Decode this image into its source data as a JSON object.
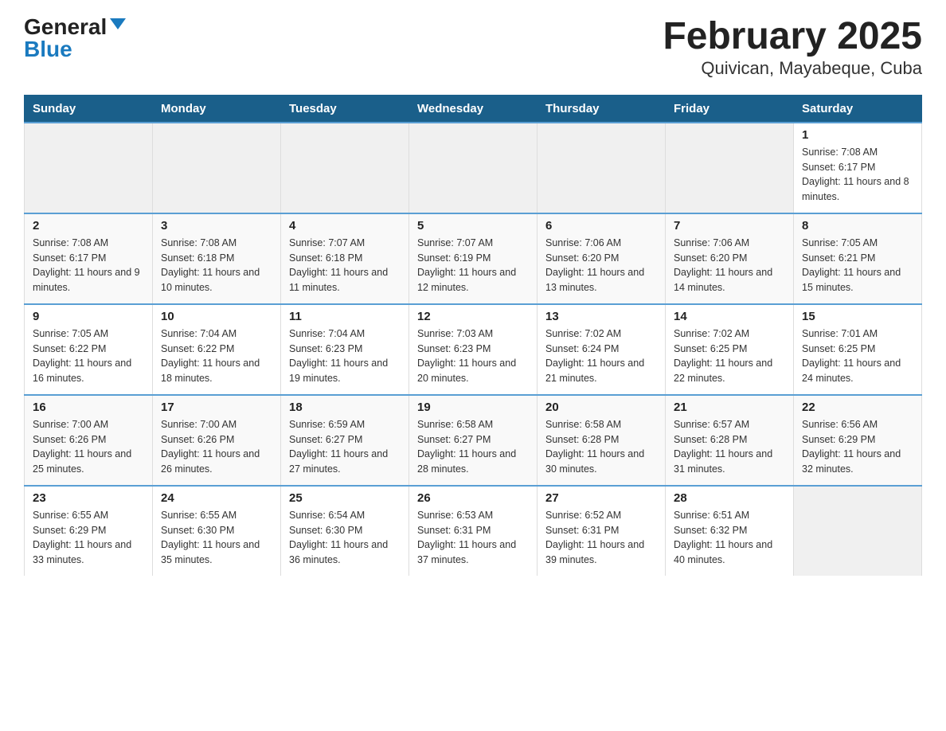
{
  "logo": {
    "general": "General",
    "blue": "Blue"
  },
  "title": "February 2025",
  "subtitle": "Quivican, Mayabeque, Cuba",
  "weekdays": [
    "Sunday",
    "Monday",
    "Tuesday",
    "Wednesday",
    "Thursday",
    "Friday",
    "Saturday"
  ],
  "weeks": [
    [
      {
        "day": "",
        "info": ""
      },
      {
        "day": "",
        "info": ""
      },
      {
        "day": "",
        "info": ""
      },
      {
        "day": "",
        "info": ""
      },
      {
        "day": "",
        "info": ""
      },
      {
        "day": "",
        "info": ""
      },
      {
        "day": "1",
        "info": "Sunrise: 7:08 AM\nSunset: 6:17 PM\nDaylight: 11 hours and 8 minutes."
      }
    ],
    [
      {
        "day": "2",
        "info": "Sunrise: 7:08 AM\nSunset: 6:17 PM\nDaylight: 11 hours and 9 minutes."
      },
      {
        "day": "3",
        "info": "Sunrise: 7:08 AM\nSunset: 6:18 PM\nDaylight: 11 hours and 10 minutes."
      },
      {
        "day": "4",
        "info": "Sunrise: 7:07 AM\nSunset: 6:18 PM\nDaylight: 11 hours and 11 minutes."
      },
      {
        "day": "5",
        "info": "Sunrise: 7:07 AM\nSunset: 6:19 PM\nDaylight: 11 hours and 12 minutes."
      },
      {
        "day": "6",
        "info": "Sunrise: 7:06 AM\nSunset: 6:20 PM\nDaylight: 11 hours and 13 minutes."
      },
      {
        "day": "7",
        "info": "Sunrise: 7:06 AM\nSunset: 6:20 PM\nDaylight: 11 hours and 14 minutes."
      },
      {
        "day": "8",
        "info": "Sunrise: 7:05 AM\nSunset: 6:21 PM\nDaylight: 11 hours and 15 minutes."
      }
    ],
    [
      {
        "day": "9",
        "info": "Sunrise: 7:05 AM\nSunset: 6:22 PM\nDaylight: 11 hours and 16 minutes."
      },
      {
        "day": "10",
        "info": "Sunrise: 7:04 AM\nSunset: 6:22 PM\nDaylight: 11 hours and 18 minutes."
      },
      {
        "day": "11",
        "info": "Sunrise: 7:04 AM\nSunset: 6:23 PM\nDaylight: 11 hours and 19 minutes."
      },
      {
        "day": "12",
        "info": "Sunrise: 7:03 AM\nSunset: 6:23 PM\nDaylight: 11 hours and 20 minutes."
      },
      {
        "day": "13",
        "info": "Sunrise: 7:02 AM\nSunset: 6:24 PM\nDaylight: 11 hours and 21 minutes."
      },
      {
        "day": "14",
        "info": "Sunrise: 7:02 AM\nSunset: 6:25 PM\nDaylight: 11 hours and 22 minutes."
      },
      {
        "day": "15",
        "info": "Sunrise: 7:01 AM\nSunset: 6:25 PM\nDaylight: 11 hours and 24 minutes."
      }
    ],
    [
      {
        "day": "16",
        "info": "Sunrise: 7:00 AM\nSunset: 6:26 PM\nDaylight: 11 hours and 25 minutes."
      },
      {
        "day": "17",
        "info": "Sunrise: 7:00 AM\nSunset: 6:26 PM\nDaylight: 11 hours and 26 minutes."
      },
      {
        "day": "18",
        "info": "Sunrise: 6:59 AM\nSunset: 6:27 PM\nDaylight: 11 hours and 27 minutes."
      },
      {
        "day": "19",
        "info": "Sunrise: 6:58 AM\nSunset: 6:27 PM\nDaylight: 11 hours and 28 minutes."
      },
      {
        "day": "20",
        "info": "Sunrise: 6:58 AM\nSunset: 6:28 PM\nDaylight: 11 hours and 30 minutes."
      },
      {
        "day": "21",
        "info": "Sunrise: 6:57 AM\nSunset: 6:28 PM\nDaylight: 11 hours and 31 minutes."
      },
      {
        "day": "22",
        "info": "Sunrise: 6:56 AM\nSunset: 6:29 PM\nDaylight: 11 hours and 32 minutes."
      }
    ],
    [
      {
        "day": "23",
        "info": "Sunrise: 6:55 AM\nSunset: 6:29 PM\nDaylight: 11 hours and 33 minutes."
      },
      {
        "day": "24",
        "info": "Sunrise: 6:55 AM\nSunset: 6:30 PM\nDaylight: 11 hours and 35 minutes."
      },
      {
        "day": "25",
        "info": "Sunrise: 6:54 AM\nSunset: 6:30 PM\nDaylight: 11 hours and 36 minutes."
      },
      {
        "day": "26",
        "info": "Sunrise: 6:53 AM\nSunset: 6:31 PM\nDaylight: 11 hours and 37 minutes."
      },
      {
        "day": "27",
        "info": "Sunrise: 6:52 AM\nSunset: 6:31 PM\nDaylight: 11 hours and 39 minutes."
      },
      {
        "day": "28",
        "info": "Sunrise: 6:51 AM\nSunset: 6:32 PM\nDaylight: 11 hours and 40 minutes."
      },
      {
        "day": "",
        "info": ""
      }
    ]
  ]
}
